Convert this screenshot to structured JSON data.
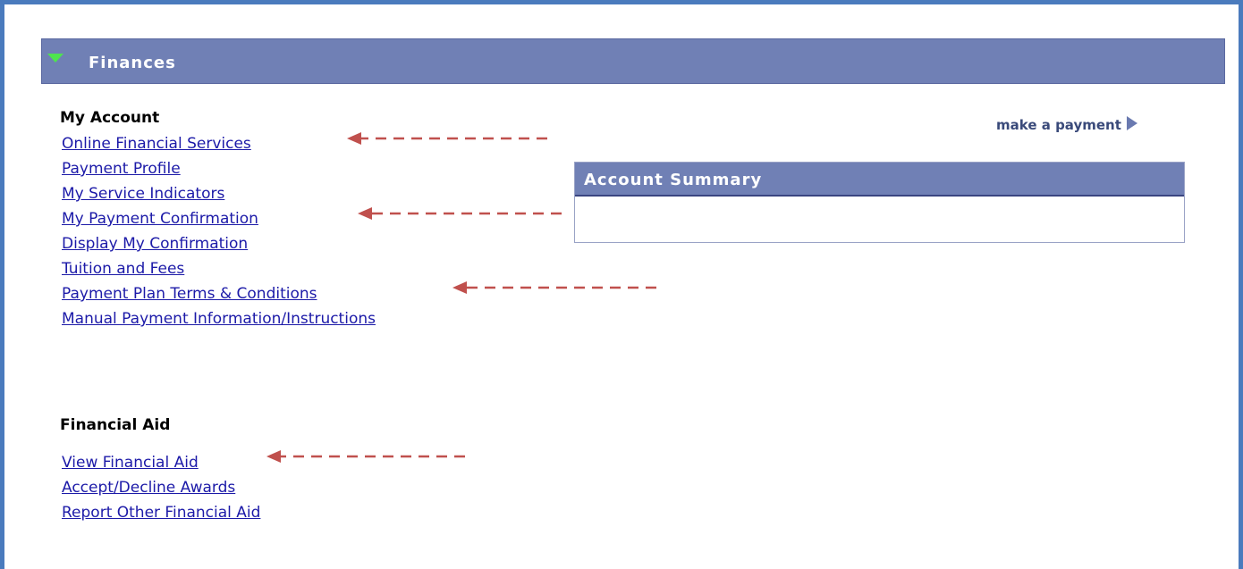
{
  "section": {
    "title": "Finances"
  },
  "my_account": {
    "heading": "My Account",
    "links": [
      "Online Financial Services",
      "Payment Profile",
      "My Service Indicators",
      "My Payment Confirmation",
      "Display My Confirmation",
      "Tuition and Fees",
      "Payment Plan Terms & Conditions",
      "Manual Payment Information/Instructions"
    ]
  },
  "make_payment": {
    "label": "make a payment"
  },
  "account_summary": {
    "title": "Account Summary"
  },
  "financial_aid": {
    "heading": "Financial Aid",
    "links": [
      "View Financial Aid",
      "Accept/Decline Awards",
      "Report Other Financial Aid"
    ]
  },
  "icons": {
    "section_toggle": "triangle-down-icon",
    "make_payment": "play-arrow-icon",
    "annotation": "dashed-arrow-icon"
  },
  "colors": {
    "frame_border": "#4a7bbd",
    "header_bg": "#7080b5",
    "link": "#1c1aa8",
    "annotation_arrow": "#c0504d",
    "toggle_icon": "#4ee44e"
  }
}
